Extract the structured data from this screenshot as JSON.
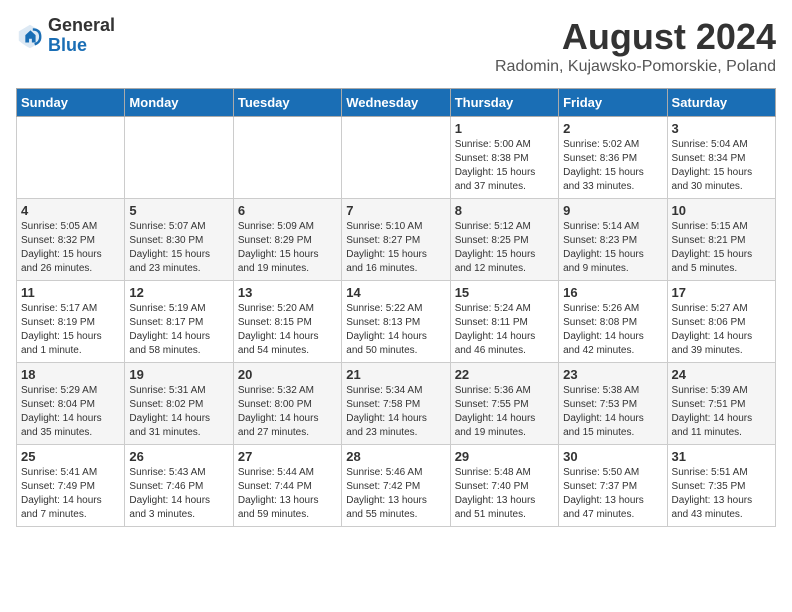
{
  "header": {
    "logo_general": "General",
    "logo_blue": "Blue",
    "month_title": "August 2024",
    "location": "Radomin, Kujawsko-Pomorskie, Poland"
  },
  "weekdays": [
    "Sunday",
    "Monday",
    "Tuesday",
    "Wednesday",
    "Thursday",
    "Friday",
    "Saturday"
  ],
  "weeks": [
    [
      {
        "day": "",
        "info": ""
      },
      {
        "day": "",
        "info": ""
      },
      {
        "day": "",
        "info": ""
      },
      {
        "day": "",
        "info": ""
      },
      {
        "day": "1",
        "info": "Sunrise: 5:00 AM\nSunset: 8:38 PM\nDaylight: 15 hours\nand 37 minutes."
      },
      {
        "day": "2",
        "info": "Sunrise: 5:02 AM\nSunset: 8:36 PM\nDaylight: 15 hours\nand 33 minutes."
      },
      {
        "day": "3",
        "info": "Sunrise: 5:04 AM\nSunset: 8:34 PM\nDaylight: 15 hours\nand 30 minutes."
      }
    ],
    [
      {
        "day": "4",
        "info": "Sunrise: 5:05 AM\nSunset: 8:32 PM\nDaylight: 15 hours\nand 26 minutes."
      },
      {
        "day": "5",
        "info": "Sunrise: 5:07 AM\nSunset: 8:30 PM\nDaylight: 15 hours\nand 23 minutes."
      },
      {
        "day": "6",
        "info": "Sunrise: 5:09 AM\nSunset: 8:29 PM\nDaylight: 15 hours\nand 19 minutes."
      },
      {
        "day": "7",
        "info": "Sunrise: 5:10 AM\nSunset: 8:27 PM\nDaylight: 15 hours\nand 16 minutes."
      },
      {
        "day": "8",
        "info": "Sunrise: 5:12 AM\nSunset: 8:25 PM\nDaylight: 15 hours\nand 12 minutes."
      },
      {
        "day": "9",
        "info": "Sunrise: 5:14 AM\nSunset: 8:23 PM\nDaylight: 15 hours\nand 9 minutes."
      },
      {
        "day": "10",
        "info": "Sunrise: 5:15 AM\nSunset: 8:21 PM\nDaylight: 15 hours\nand 5 minutes."
      }
    ],
    [
      {
        "day": "11",
        "info": "Sunrise: 5:17 AM\nSunset: 8:19 PM\nDaylight: 15 hours\nand 1 minute."
      },
      {
        "day": "12",
        "info": "Sunrise: 5:19 AM\nSunset: 8:17 PM\nDaylight: 14 hours\nand 58 minutes."
      },
      {
        "day": "13",
        "info": "Sunrise: 5:20 AM\nSunset: 8:15 PM\nDaylight: 14 hours\nand 54 minutes."
      },
      {
        "day": "14",
        "info": "Sunrise: 5:22 AM\nSunset: 8:13 PM\nDaylight: 14 hours\nand 50 minutes."
      },
      {
        "day": "15",
        "info": "Sunrise: 5:24 AM\nSunset: 8:11 PM\nDaylight: 14 hours\nand 46 minutes."
      },
      {
        "day": "16",
        "info": "Sunrise: 5:26 AM\nSunset: 8:08 PM\nDaylight: 14 hours\nand 42 minutes."
      },
      {
        "day": "17",
        "info": "Sunrise: 5:27 AM\nSunset: 8:06 PM\nDaylight: 14 hours\nand 39 minutes."
      }
    ],
    [
      {
        "day": "18",
        "info": "Sunrise: 5:29 AM\nSunset: 8:04 PM\nDaylight: 14 hours\nand 35 minutes."
      },
      {
        "day": "19",
        "info": "Sunrise: 5:31 AM\nSunset: 8:02 PM\nDaylight: 14 hours\nand 31 minutes."
      },
      {
        "day": "20",
        "info": "Sunrise: 5:32 AM\nSunset: 8:00 PM\nDaylight: 14 hours\nand 27 minutes."
      },
      {
        "day": "21",
        "info": "Sunrise: 5:34 AM\nSunset: 7:58 PM\nDaylight: 14 hours\nand 23 minutes."
      },
      {
        "day": "22",
        "info": "Sunrise: 5:36 AM\nSunset: 7:55 PM\nDaylight: 14 hours\nand 19 minutes."
      },
      {
        "day": "23",
        "info": "Sunrise: 5:38 AM\nSunset: 7:53 PM\nDaylight: 14 hours\nand 15 minutes."
      },
      {
        "day": "24",
        "info": "Sunrise: 5:39 AM\nSunset: 7:51 PM\nDaylight: 14 hours\nand 11 minutes."
      }
    ],
    [
      {
        "day": "25",
        "info": "Sunrise: 5:41 AM\nSunset: 7:49 PM\nDaylight: 14 hours\nand 7 minutes."
      },
      {
        "day": "26",
        "info": "Sunrise: 5:43 AM\nSunset: 7:46 PM\nDaylight: 14 hours\nand 3 minutes."
      },
      {
        "day": "27",
        "info": "Sunrise: 5:44 AM\nSunset: 7:44 PM\nDaylight: 13 hours\nand 59 minutes."
      },
      {
        "day": "28",
        "info": "Sunrise: 5:46 AM\nSunset: 7:42 PM\nDaylight: 13 hours\nand 55 minutes."
      },
      {
        "day": "29",
        "info": "Sunrise: 5:48 AM\nSunset: 7:40 PM\nDaylight: 13 hours\nand 51 minutes."
      },
      {
        "day": "30",
        "info": "Sunrise: 5:50 AM\nSunset: 7:37 PM\nDaylight: 13 hours\nand 47 minutes."
      },
      {
        "day": "31",
        "info": "Sunrise: 5:51 AM\nSunset: 7:35 PM\nDaylight: 13 hours\nand 43 minutes."
      }
    ]
  ]
}
